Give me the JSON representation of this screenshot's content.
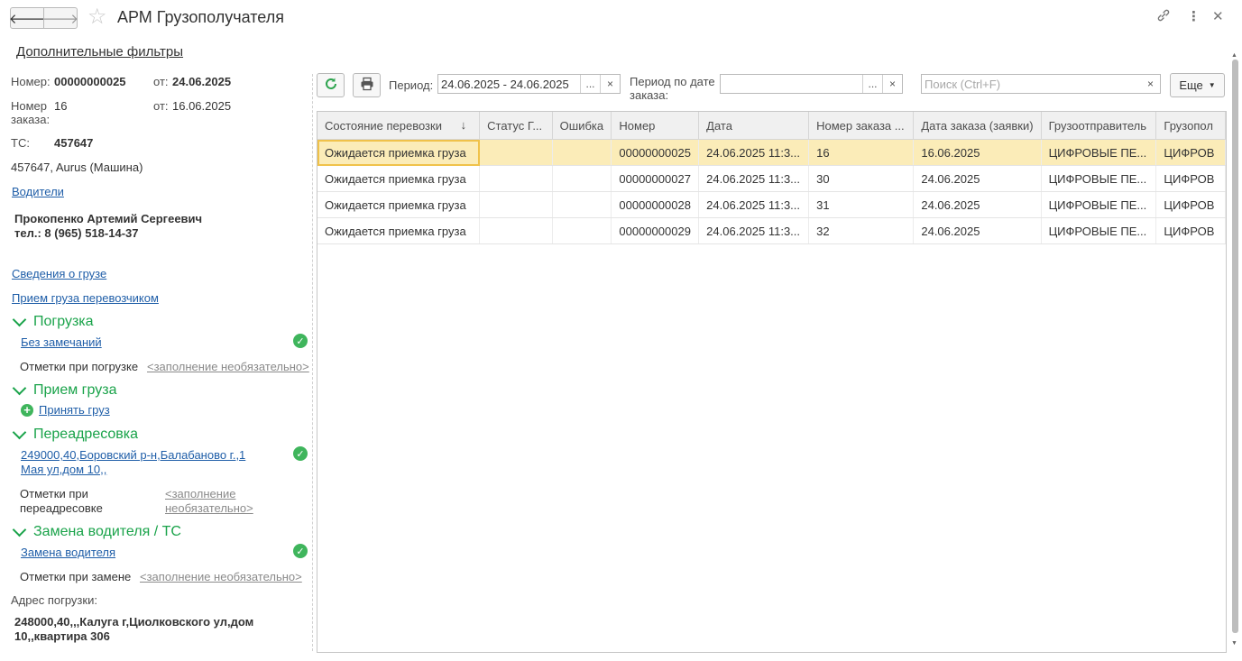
{
  "window": {
    "title": "АРМ Грузополучателя",
    "back_icon": "🡐",
    "forward_icon": "🡒"
  },
  "left": {
    "filters_link": "Дополнительные фильтры",
    "number_label": "Номер:",
    "number_value": "00000000025",
    "from_label": "от:",
    "number_date": "24.06.2025",
    "order_label": "Номер заказа:",
    "order_value": "16",
    "order_from_label": "от:",
    "order_date": "16.06.2025",
    "ts_label": "ТС:",
    "ts_value": "457647",
    "vehicle": "457647, Aurus (Машина)",
    "drivers_link": "Водители",
    "driver_name": "Прокопенко Артемий Сергеевич",
    "driver_phone": "тел.: 8 (965) 518-14-37",
    "cargo_info_link": "Сведения о грузе",
    "carrier_receive_link": "Прием груза перевозчиком",
    "loading": {
      "title": "Погрузка",
      "status_link": "Без замечаний",
      "notes_label": "Отметки при погрузке",
      "notes_value": "<заполнение необязательно>"
    },
    "receive": {
      "title": "Прием груза",
      "action_link": "Принять груз"
    },
    "redirect": {
      "title": "Переадресовка",
      "address_link": "249000,40,Боровский р-н,Балабаново г.,1 Мая ул,дом 10,,",
      "notes_label": "Отметки при переадресовке",
      "notes_value": "<заполнение необязательно>"
    },
    "replace": {
      "title": "Замена водителя / ТС",
      "action_link": "Замена водителя",
      "notes_label": "Отметки при замене",
      "notes_value": "<заполнение необязательно>"
    },
    "load_address_label": "Адрес погрузки:",
    "load_address": "248000,40,,,Калуга г,Циолковского ул,дом 10,,квартира 306"
  },
  "toolbar": {
    "period_label": "Период:",
    "period_value": "24.06.2025 - 24.06.2025",
    "order_period_label": "Период по дате заказа:",
    "order_period_value": "",
    "search_placeholder": "Поиск (Ctrl+F)",
    "more_label": "Еще",
    "dots": "...",
    "clear": "×"
  },
  "table": {
    "columns": [
      "Состояние перевозки",
      "Статус Г...",
      "Ошибка",
      "Номер",
      "Дата",
      "Номер заказа ...",
      "Дата заказа (заявки)",
      "Грузоотправитель",
      "Грузопол"
    ],
    "sort_icon": "↓",
    "rows": [
      [
        "Ожидается приемка груза",
        "",
        "",
        "00000000025",
        "24.06.2025 11:3...",
        "16",
        "16.06.2025",
        "ЦИФРОВЫЕ ПЕ...",
        "ЦИФРОВ"
      ],
      [
        "Ожидается приемка груза",
        "",
        "",
        "00000000027",
        "24.06.2025 11:3...",
        "30",
        "24.06.2025",
        "ЦИФРОВЫЕ ПЕ...",
        "ЦИФРОВ"
      ],
      [
        "Ожидается приемка груза",
        "",
        "",
        "00000000028",
        "24.06.2025 11:3...",
        "31",
        "24.06.2025",
        "ЦИФРОВЫЕ ПЕ...",
        "ЦИФРОВ"
      ],
      [
        "Ожидается приемка груза",
        "",
        "",
        "00000000029",
        "24.06.2025 11:3...",
        "32",
        "24.06.2025",
        "ЦИФРОВЫЕ ПЕ...",
        "ЦИФРОВ"
      ]
    ]
  },
  "colors": {
    "accent_green": "#1aa34a",
    "link": "#1f5ea8",
    "selected_row": "#fbecb8"
  }
}
